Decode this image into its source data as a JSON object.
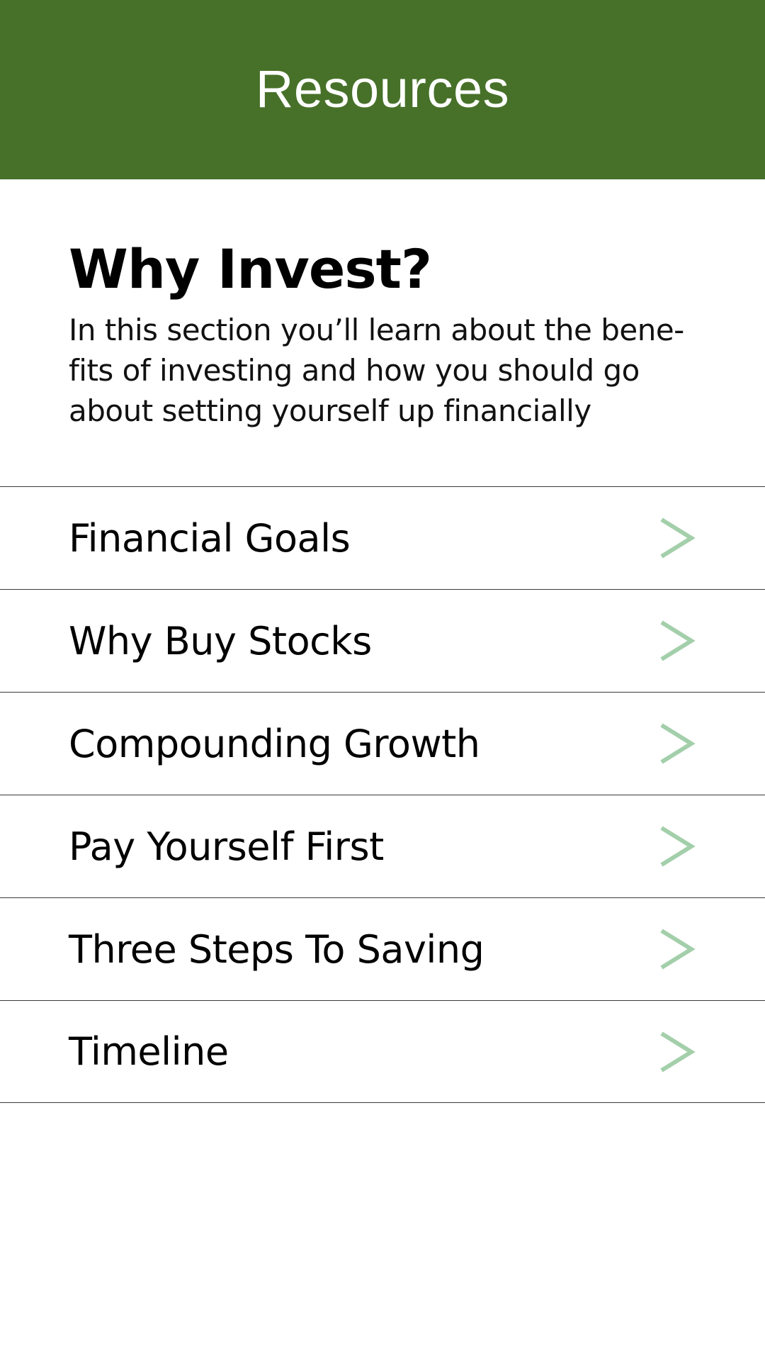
{
  "theme": {
    "header_bg": "#477129",
    "chevron_color": "#a3cfaa"
  },
  "header": {
    "title": "Resources"
  },
  "intro": {
    "heading": "Why Invest?",
    "description": "In this section you’ll learn about the bene-fits of investing and how you should go about setting yourself up financially"
  },
  "items": [
    {
      "label": "Financial Goals",
      "icon": "chevron-right-icon"
    },
    {
      "label": "Why Buy Stocks",
      "icon": "chevron-right-icon"
    },
    {
      "label": "Compounding Growth",
      "icon": "chevron-right-icon"
    },
    {
      "label": "Pay Yourself First",
      "icon": "chevron-right-icon"
    },
    {
      "label": "Three Steps To Saving",
      "icon": "chevron-right-icon"
    },
    {
      "label": "Timeline",
      "icon": "chevron-right-icon"
    }
  ]
}
